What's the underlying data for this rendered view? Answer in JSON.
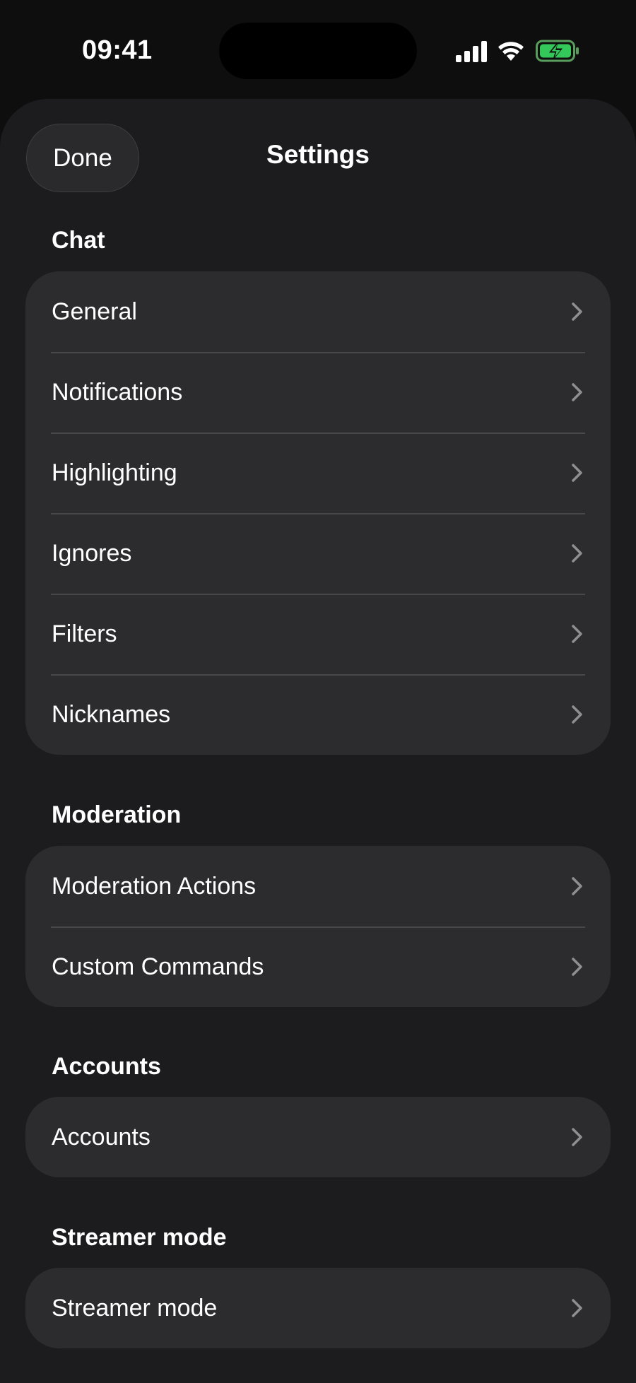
{
  "status_bar": {
    "time": "09:41",
    "icons": [
      "cellular-signal-icon",
      "wifi-icon",
      "battery-charging-icon"
    ],
    "battery_color": "#34c759"
  },
  "header": {
    "done_label": "Done",
    "title": "Settings"
  },
  "sections": [
    {
      "header": "Chat",
      "items": [
        {
          "label": "General"
        },
        {
          "label": "Notifications"
        },
        {
          "label": "Highlighting"
        },
        {
          "label": "Ignores"
        },
        {
          "label": "Filters"
        },
        {
          "label": "Nicknames"
        }
      ]
    },
    {
      "header": "Moderation",
      "items": [
        {
          "label": "Moderation Actions"
        },
        {
          "label": "Custom Commands"
        }
      ]
    },
    {
      "header": "Accounts",
      "items": [
        {
          "label": "Accounts"
        }
      ]
    },
    {
      "header": "Streamer mode",
      "items": [
        {
          "label": "Streamer mode"
        }
      ]
    }
  ],
  "colors": {
    "background": "#0e0e0f",
    "sheet": "#1c1c1e",
    "group": "#2c2c2e",
    "separator": "#48484b",
    "chevron": "#8e8e93"
  }
}
